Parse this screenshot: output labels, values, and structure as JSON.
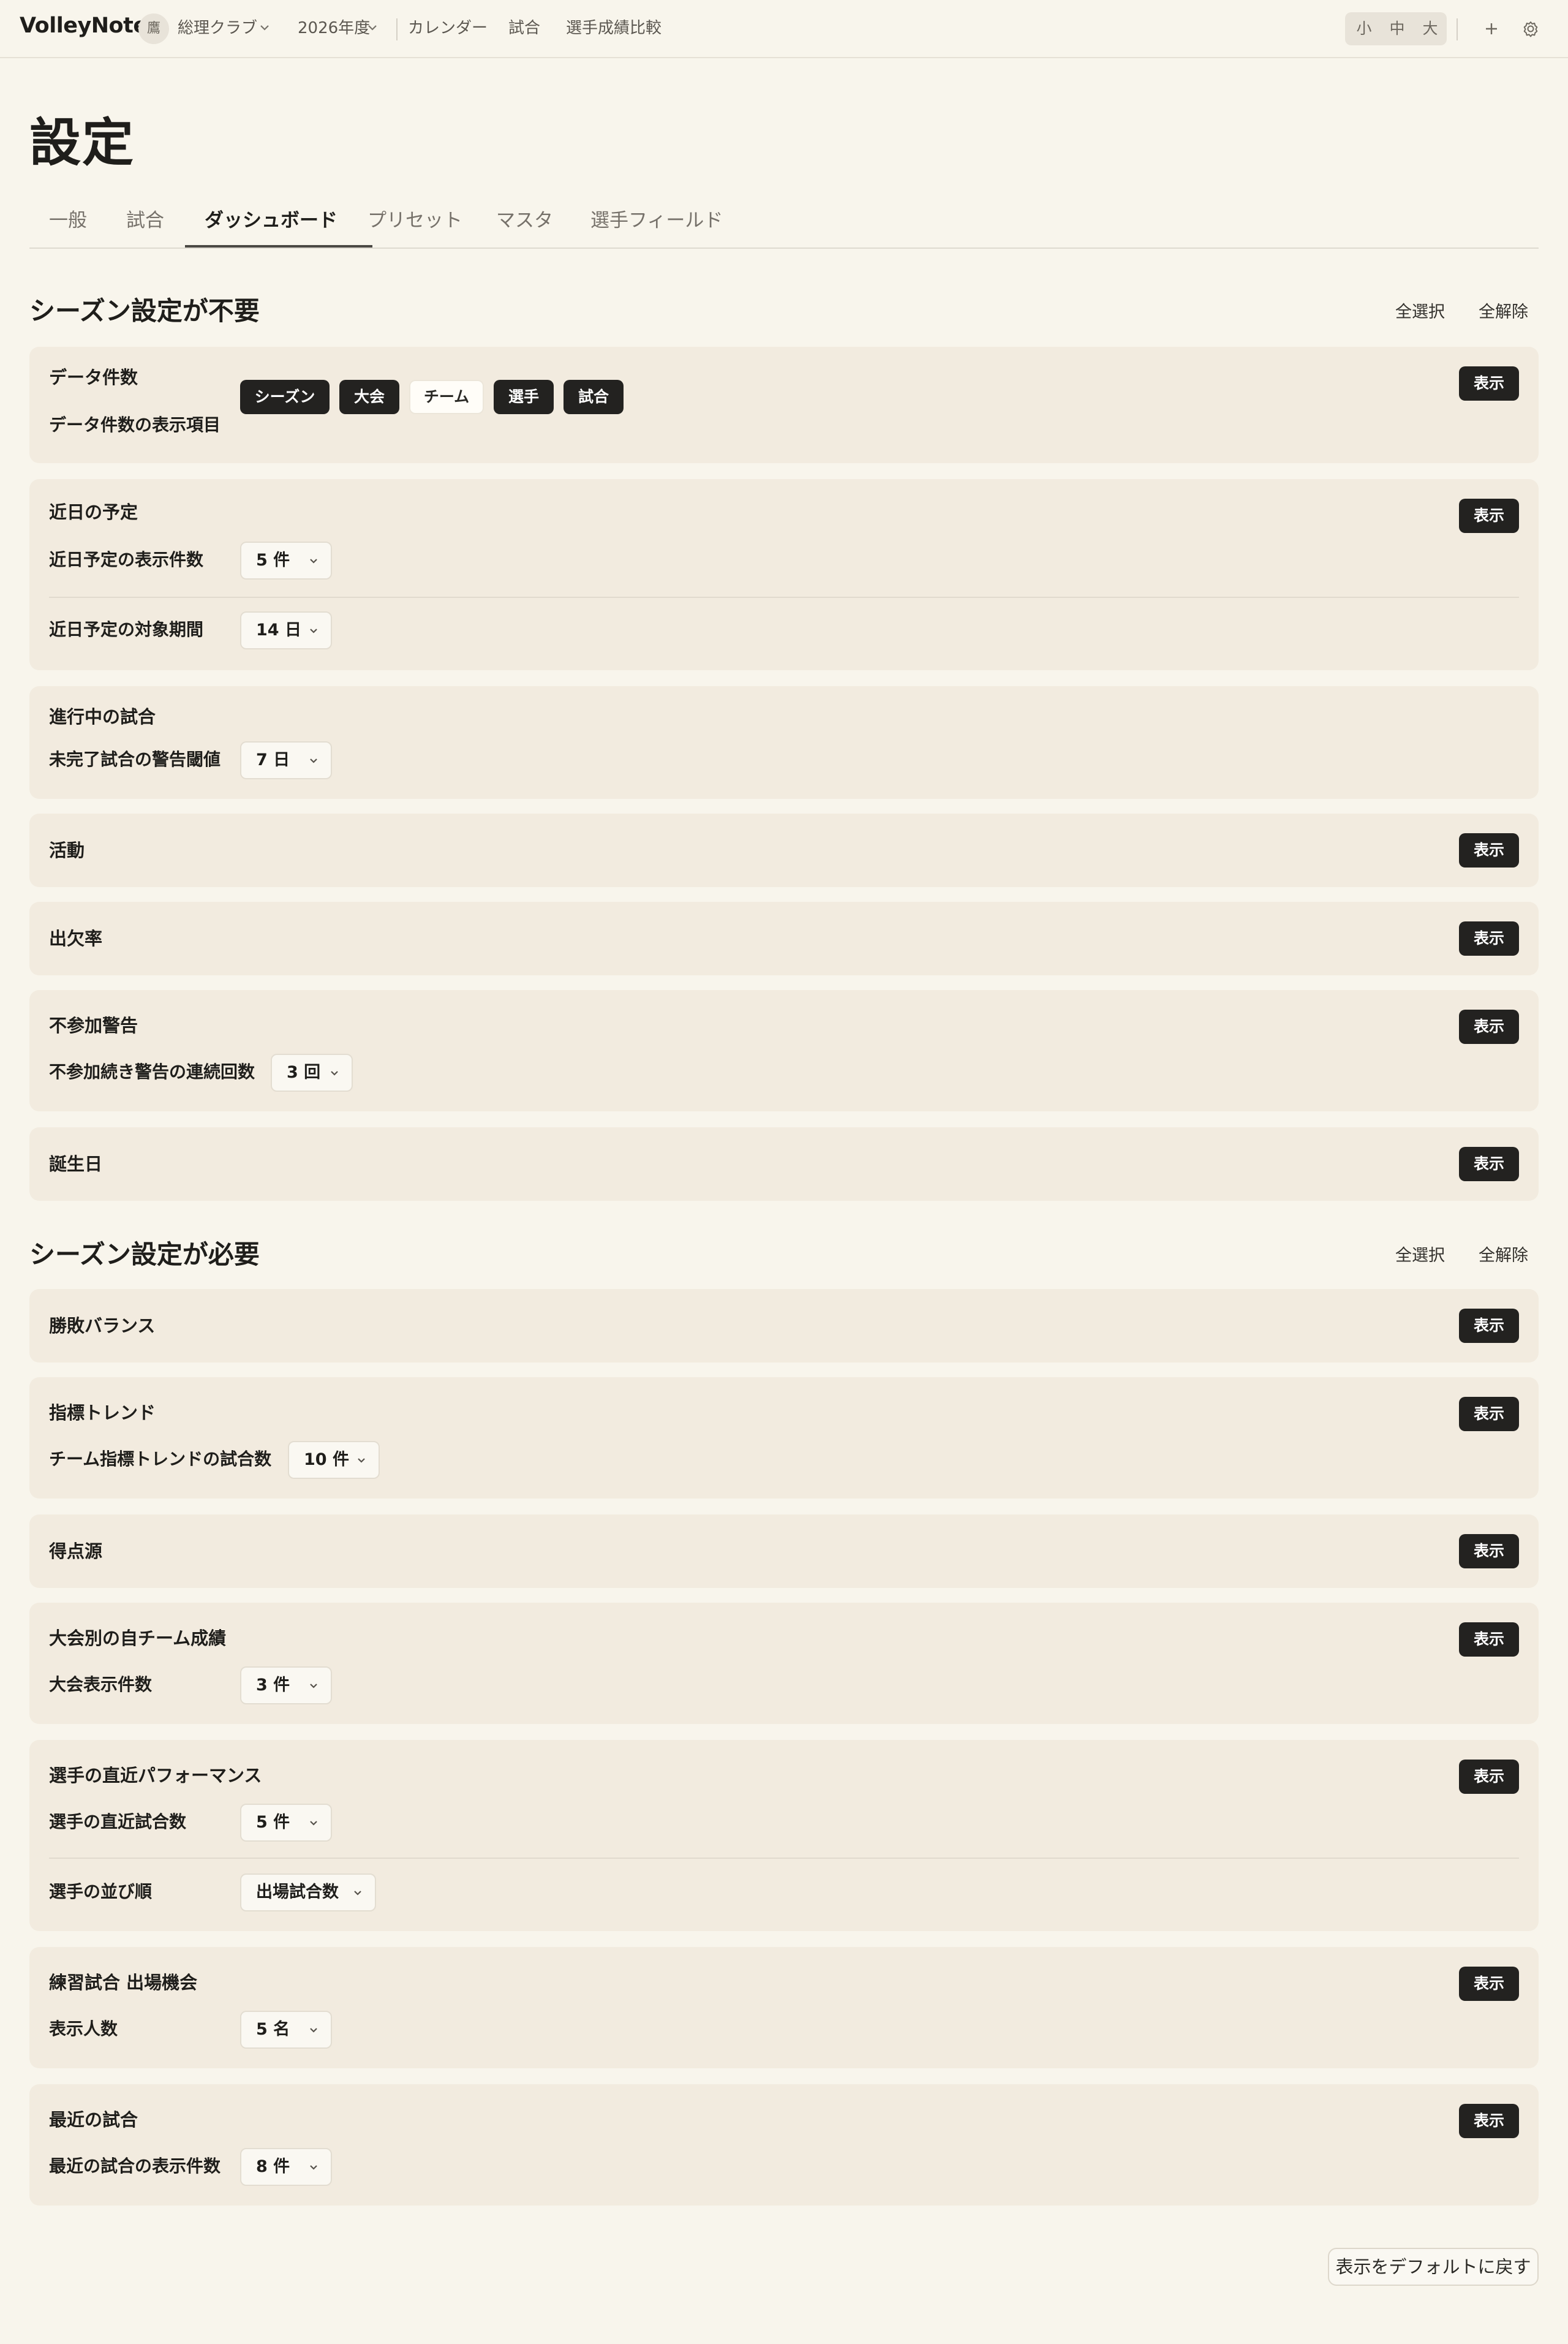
{
  "app": {
    "title": "VolleyNote"
  },
  "header": {
    "club_initial": "鷹",
    "club_name": "総理クラブ",
    "season": "2026年度",
    "nav": [
      "カレンダー",
      "試合",
      "選手成績比較"
    ],
    "font_sizes": [
      "小",
      "中",
      "大"
    ],
    "icons": [
      "chevron-down-icon",
      "plus-icon",
      "gear-icon"
    ]
  },
  "page": {
    "title": "設定",
    "tabs": [
      "一般",
      "試合",
      "ダッシュボード",
      "プリセット",
      "マスタ",
      "選手フィールド"
    ],
    "active_tab": "ダッシュボード"
  },
  "section1": {
    "title": "シーズン設定が不要",
    "select_all": "全選択",
    "clear_all": "全解除",
    "cards": {
      "data_count": {
        "title": "データ件数",
        "show": "表示",
        "items_label": "データ件数の表示項目",
        "chips": [
          {
            "label": "シーズン",
            "selected": true
          },
          {
            "label": "大会",
            "selected": true
          },
          {
            "label": "チーム",
            "selected": false
          },
          {
            "label": "選手",
            "selected": true
          },
          {
            "label": "試合",
            "selected": true
          }
        ]
      },
      "upcoming": {
        "title": "近日の予定",
        "show": "表示",
        "count_label": "近日予定の表示件数",
        "count_value": "5 件",
        "period_label": "近日予定の対象期間",
        "period_value": "14 日"
      },
      "in_progress": {
        "title": "進行中の試合",
        "threshold_label": "未完了試合の警告閾値",
        "threshold_value": "7 日"
      },
      "activity": {
        "title": "活動",
        "show": "表示"
      },
      "attendance": {
        "title": "出欠率",
        "show": "表示"
      },
      "absence_warning": {
        "title": "不参加警告",
        "show": "表示",
        "streak_label": "不参加続き警告の連続回数",
        "streak_value": "3 回"
      },
      "birthday": {
        "title": "誕生日",
        "show": "表示"
      }
    }
  },
  "section2": {
    "title": "シーズン設定が必要",
    "select_all": "全選択",
    "clear_all": "全解除",
    "cards": {
      "win_loss": {
        "title": "勝敗バランス",
        "show": "表示"
      },
      "metric_trend": {
        "title": "指標トレンド",
        "show": "表示",
        "games_label": "チーム指標トレンドの試合数",
        "games_value": "10 件"
      },
      "scoring_source": {
        "title": "得点源",
        "show": "表示"
      },
      "tournament_results": {
        "title": "大会別の自チーム成績",
        "show": "表示",
        "count_label": "大会表示件数",
        "count_value": "3 件"
      },
      "player_recent": {
        "title": "選手の直近パフォーマンス",
        "show": "表示",
        "games_label": "選手の直近試合数",
        "games_value": "5 件",
        "order_label": "選手の並び順",
        "order_value": "出場試合数"
      },
      "practice_opportunity": {
        "title": "練習試合 出場機会",
        "show": "表示",
        "people_label": "表示人数",
        "people_value": "5 名"
      },
      "recent_games": {
        "title": "最近の試合",
        "show": "表示",
        "count_label": "最近の試合の表示件数",
        "count_value": "8 件"
      }
    }
  },
  "footer": {
    "reset": "表示をデフォルトに戻す"
  }
}
